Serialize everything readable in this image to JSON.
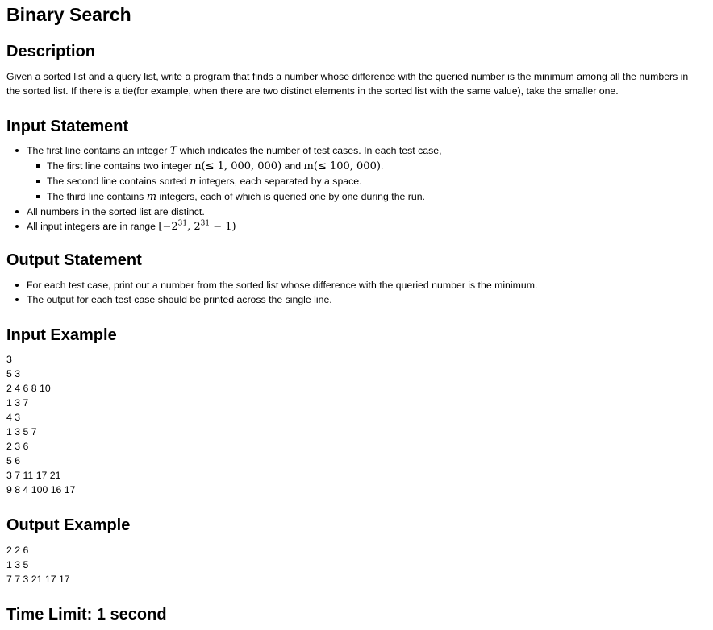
{
  "title": "Binary Search",
  "description": {
    "heading": "Description",
    "line1": "Given a sorted list and a query list, write a program that finds a number whose difference with the queried number is the minimum among all the numbers in",
    "line2": "the sorted list. If there is a tie(for example, when there are two distinct elements in the sorted list with the same value), take the smaller one."
  },
  "input_statement": {
    "heading": "Input Statement",
    "item1_pre": "The first line contains an integer",
    "item1_var": "T",
    "item1_post": "which indicates the number of test cases. In each test case,",
    "sub1_pre": "The first line contains two integer",
    "sub1_math1": "n(≤ 1, 000, 000)",
    "sub1_mid": "and",
    "sub1_math2": "m(≤ 100, 000)",
    "sub1_post": ".",
    "sub2_pre": "The second line contains sorted",
    "sub2_var": "n",
    "sub2_post": "integers, each separated by a space.",
    "sub3_pre": "The third line contains",
    "sub3_var": "m",
    "sub3_post": "integers, each of which is queried one by one during the run.",
    "item2": "All numbers in the sorted list are distinct.",
    "item3_pre": "All input integers are in range",
    "item3_math_a": "[−2",
    "item3_sup_a": "31",
    "item3_math_b": ", 2",
    "item3_sup_b": "31",
    "item3_math_c": " − 1)"
  },
  "output_statement": {
    "heading": "Output Statement",
    "item1": "For each test case, print out a number from the sorted list whose difference with the queried number is the minimum.",
    "item2": "The output for each test case should be printed across the single line."
  },
  "input_example": {
    "heading": "Input Example",
    "lines": [
      "3",
      "5 3",
      "2 4 6 8 10",
      "1 3 7",
      "4 3",
      "1 3 5 7",
      "2 3 6",
      "5 6",
      "3 7 11 17 21",
      "9 8 4 100 16 17"
    ]
  },
  "output_example": {
    "heading": "Output Example",
    "lines": [
      "2 2 6",
      "1 3 5",
      "7 7 3 21 17 17"
    ]
  },
  "time_limit": "Time Limit: 1 second"
}
